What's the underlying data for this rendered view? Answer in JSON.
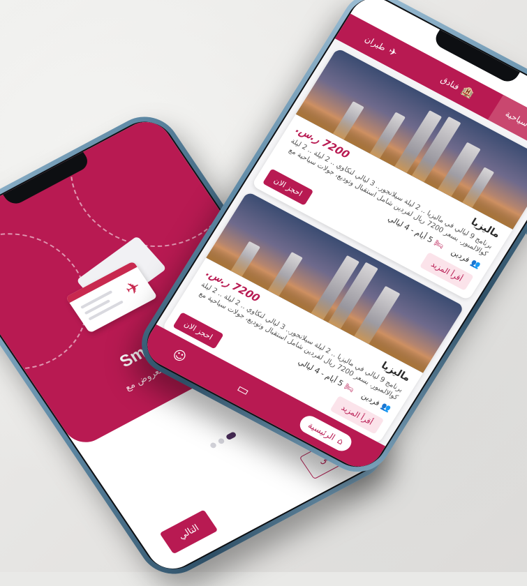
{
  "onboarding": {
    "title": "Smart Trip",
    "description": "رحلات والعروض مع Smart",
    "next_label": "التالي",
    "skip_label": "تخطى",
    "page_dots": 3,
    "active_dot": 2
  },
  "trips_app": {
    "tabs": [
      {
        "label": "برامج سياحية",
        "icon": "bus-icon",
        "active": true
      },
      {
        "label": "فنادق",
        "icon": "hotel-icon",
        "active": false
      },
      {
        "label": "طيران",
        "icon": "plane-icon",
        "active": false
      }
    ],
    "cards": [
      {
        "destination": "ماليزيا",
        "price": "7200 ر.س.",
        "description": "برنامج 9 ليالي في ماليزيا .. 2 ليلة سيلانجور.. 3 ليالي لنكاوي .. 2 ليلة .. 2 ليلة كوالالمبور. بسعر 7200 ريال لفردين شامل استقبال وتوديع، جولات سياحية مع",
        "travellers": "فردين",
        "duration": "5 أيام - 4 ليالي",
        "more_label": "أقرأ المزيد",
        "book_label": "احجز الان"
      },
      {
        "destination": "ماليزيا",
        "price": "7200 ر.س.",
        "description": "برنامج 9 ليالي في ماليزيا .. 2 ليلة سيلانجور.. 3 ليالي لنكاوي .. 2 ليلة .. 2 ليلة كوالالمبور. بسعر 7200 ريال لفردين شامل استقبال وتوديع، جولات سياحية مع",
        "travellers": "فردين",
        "duration": "5 أيام - 4 ليالي",
        "more_label": "أقرأ المزيد",
        "book_label": "احجز الان"
      }
    ],
    "bottom_nav": {
      "home_label": "الرئيسية",
      "items": [
        "home-icon",
        "ticket-icon",
        "profile-icon"
      ]
    }
  },
  "colors": {
    "primary": "#b81a52",
    "primary_light": "#fbe3ea",
    "frame": "#5f8aa6"
  }
}
